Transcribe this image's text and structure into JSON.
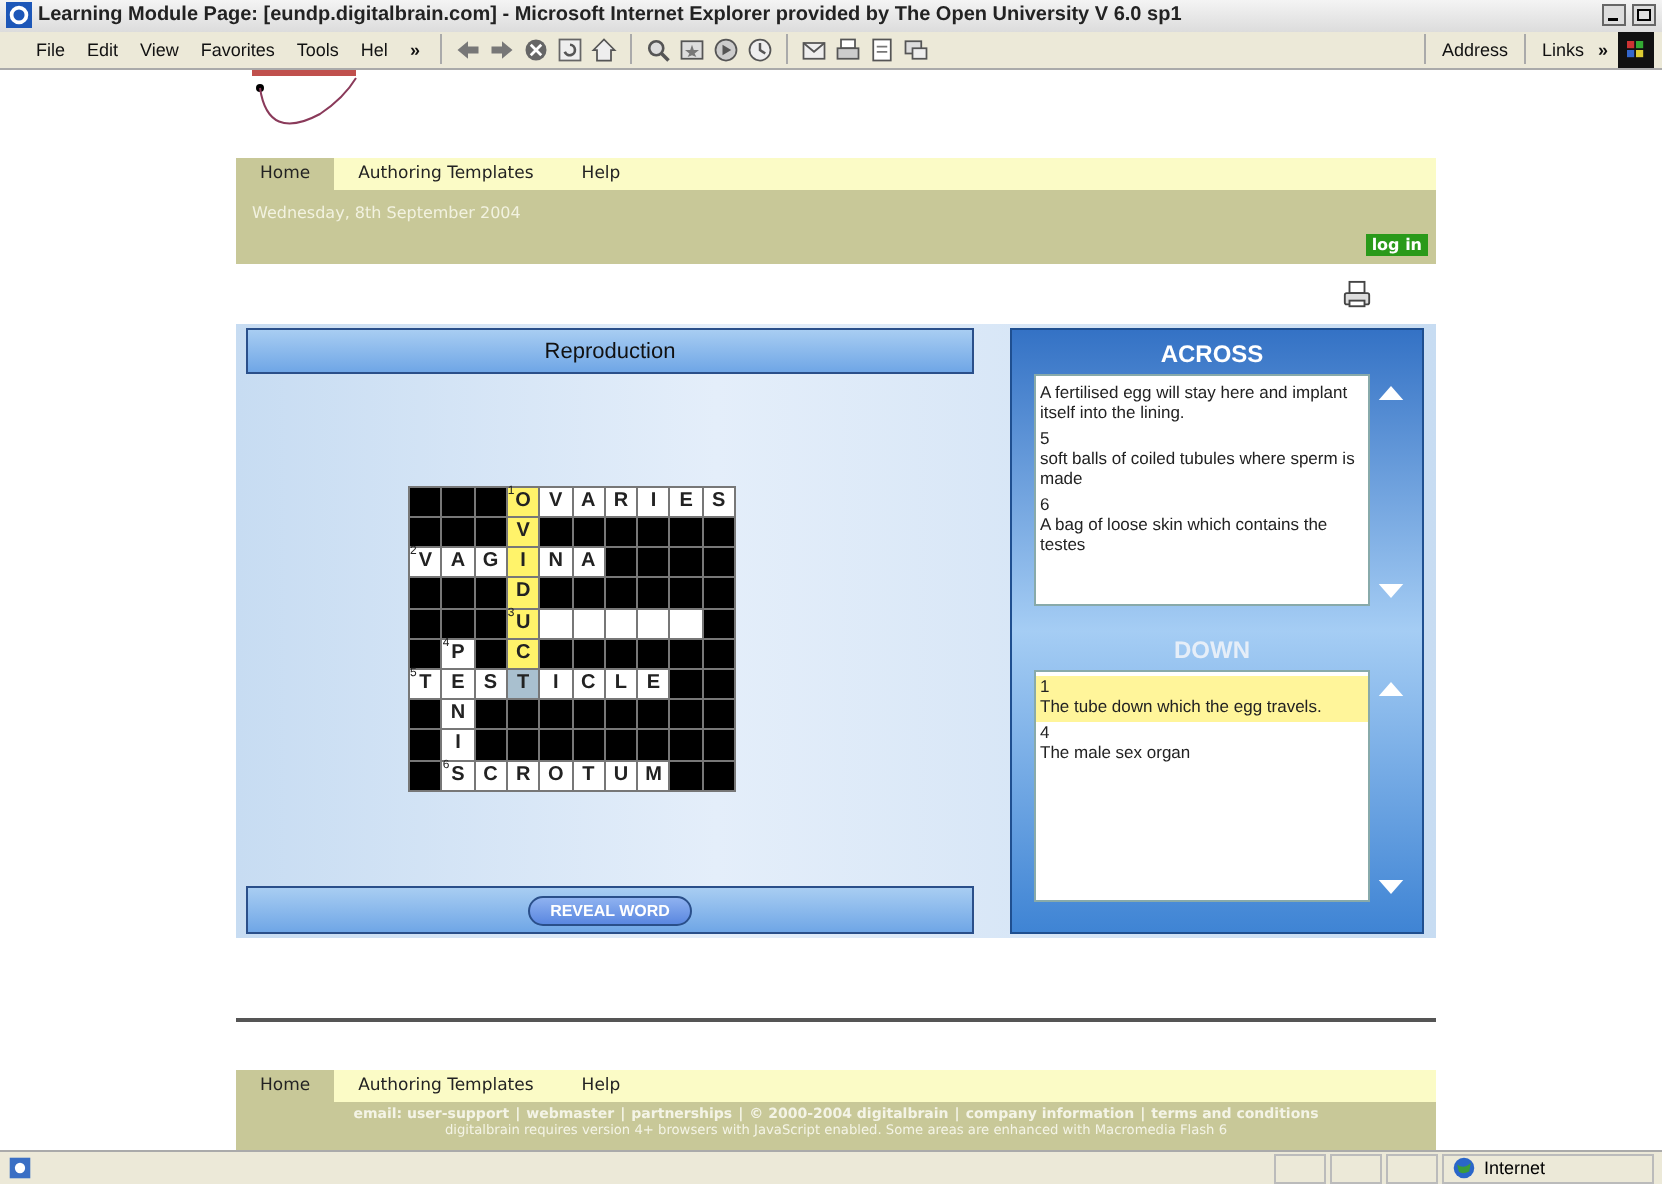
{
  "window": {
    "title": "Learning Module Page: [eundp.digitalbrain.com] - Microsoft Internet Explorer provided by The Open University V 6.0 sp1"
  },
  "menu": [
    "File",
    "Edit",
    "View",
    "Favorites",
    "Tools",
    "Hel"
  ],
  "menu_more": "»",
  "address_label": "Address",
  "links_label": "Links",
  "links_more": "»",
  "nav": [
    {
      "label": "Home",
      "selected": true
    },
    {
      "label": "Authoring Templates",
      "selected": false
    },
    {
      "label": "Help",
      "selected": false
    }
  ],
  "date": "Wednesday, 8th September 2004",
  "login": "log in",
  "puzzle": {
    "title": "Reproduction",
    "reveal": "REVEAL WORD",
    "grid": [
      [
        {
          "kind": "block"
        },
        {
          "kind": "block"
        },
        {
          "kind": "block"
        },
        {
          "kind": "letter",
          "letter": "O",
          "number": "1",
          "in_word": true,
          "selected": false
        },
        {
          "kind": "letter",
          "letter": "V",
          "in_word": false,
          "selected": false
        },
        {
          "kind": "letter",
          "letter": "A",
          "in_word": false,
          "selected": false
        },
        {
          "kind": "letter",
          "letter": "R",
          "in_word": false,
          "selected": false
        },
        {
          "kind": "letter",
          "letter": "I",
          "in_word": false,
          "selected": false
        },
        {
          "kind": "letter",
          "letter": "E",
          "in_word": false,
          "selected": false
        },
        {
          "kind": "letter",
          "letter": "S",
          "in_word": false,
          "selected": false
        }
      ],
      [
        {
          "kind": "block"
        },
        {
          "kind": "block"
        },
        {
          "kind": "block"
        },
        {
          "kind": "letter",
          "letter": "V",
          "in_word": true,
          "selected": false
        },
        {
          "kind": "block"
        },
        {
          "kind": "block"
        },
        {
          "kind": "block"
        },
        {
          "kind": "block"
        },
        {
          "kind": "block"
        },
        {
          "kind": "block"
        }
      ],
      [
        {
          "kind": "letter",
          "letter": "V",
          "number": "2",
          "in_word": false,
          "selected": false
        },
        {
          "kind": "letter",
          "letter": "A",
          "in_word": false,
          "selected": false
        },
        {
          "kind": "letter",
          "letter": "G",
          "in_word": false,
          "selected": false
        },
        {
          "kind": "letter",
          "letter": "I",
          "in_word": true,
          "selected": false
        },
        {
          "kind": "letter",
          "letter": "N",
          "in_word": false,
          "selected": false
        },
        {
          "kind": "letter",
          "letter": "A",
          "in_word": false,
          "selected": false
        },
        {
          "kind": "block"
        },
        {
          "kind": "block"
        },
        {
          "kind": "block"
        },
        {
          "kind": "block"
        }
      ],
      [
        {
          "kind": "block"
        },
        {
          "kind": "block"
        },
        {
          "kind": "block"
        },
        {
          "kind": "letter",
          "letter": "D",
          "in_word": true,
          "selected": false
        },
        {
          "kind": "block"
        },
        {
          "kind": "block"
        },
        {
          "kind": "block"
        },
        {
          "kind": "block"
        },
        {
          "kind": "block"
        },
        {
          "kind": "block"
        }
      ],
      [
        {
          "kind": "block"
        },
        {
          "kind": "block"
        },
        {
          "kind": "block"
        },
        {
          "kind": "letter",
          "letter": "U",
          "number": "3",
          "in_word": true,
          "selected": false
        },
        {
          "kind": "blank"
        },
        {
          "kind": "blank"
        },
        {
          "kind": "blank"
        },
        {
          "kind": "blank"
        },
        {
          "kind": "blank"
        },
        {
          "kind": "block"
        }
      ],
      [
        {
          "kind": "block"
        },
        {
          "kind": "letter",
          "letter": "P",
          "number": "4",
          "in_word": false,
          "selected": false
        },
        {
          "kind": "block"
        },
        {
          "kind": "letter",
          "letter": "C",
          "in_word": true,
          "selected": false
        },
        {
          "kind": "block"
        },
        {
          "kind": "block"
        },
        {
          "kind": "block"
        },
        {
          "kind": "block"
        },
        {
          "kind": "block"
        },
        {
          "kind": "block"
        }
      ],
      [
        {
          "kind": "letter",
          "letter": "T",
          "number": "5",
          "in_word": false,
          "selected": false
        },
        {
          "kind": "letter",
          "letter": "E",
          "in_word": false,
          "selected": false
        },
        {
          "kind": "letter",
          "letter": "S",
          "in_word": false,
          "selected": false
        },
        {
          "kind": "letter",
          "letter": "T",
          "in_word": false,
          "selected": true
        },
        {
          "kind": "letter",
          "letter": "I",
          "in_word": false,
          "selected": false
        },
        {
          "kind": "letter",
          "letter": "C",
          "in_word": false,
          "selected": false
        },
        {
          "kind": "letter",
          "letter": "L",
          "in_word": false,
          "selected": false
        },
        {
          "kind": "letter",
          "letter": "E",
          "in_word": false,
          "selected": false
        },
        {
          "kind": "block"
        },
        {
          "kind": "block"
        }
      ],
      [
        {
          "kind": "block"
        },
        {
          "kind": "letter",
          "letter": "N",
          "in_word": false,
          "selected": false
        },
        {
          "kind": "block"
        },
        {
          "kind": "block"
        },
        {
          "kind": "block"
        },
        {
          "kind": "block"
        },
        {
          "kind": "block"
        },
        {
          "kind": "block"
        },
        {
          "kind": "block"
        },
        {
          "kind": "block"
        }
      ],
      [
        {
          "kind": "block"
        },
        {
          "kind": "letter",
          "letter": "I",
          "in_word": false,
          "selected": false
        },
        {
          "kind": "block"
        },
        {
          "kind": "block"
        },
        {
          "kind": "block"
        },
        {
          "kind": "block"
        },
        {
          "kind": "block"
        },
        {
          "kind": "block"
        },
        {
          "kind": "block"
        },
        {
          "kind": "block"
        }
      ],
      [
        {
          "kind": "block"
        },
        {
          "kind": "letter",
          "letter": "S",
          "number": "6",
          "in_word": false,
          "selected": false
        },
        {
          "kind": "letter",
          "letter": "C",
          "in_word": false,
          "selected": false
        },
        {
          "kind": "letter",
          "letter": "R",
          "in_word": false,
          "selected": false
        },
        {
          "kind": "letter",
          "letter": "O",
          "in_word": false,
          "selected": false
        },
        {
          "kind": "letter",
          "letter": "T",
          "in_word": false,
          "selected": false
        },
        {
          "kind": "letter",
          "letter": "U",
          "in_word": false,
          "selected": false
        },
        {
          "kind": "letter",
          "letter": "M",
          "in_word": false,
          "selected": false
        },
        {
          "kind": "block"
        },
        {
          "kind": "block"
        }
      ]
    ]
  },
  "clue_panels": [
    {
      "title": "ACROSS",
      "active": true,
      "clues": [
        {
          "text": "A fertilised egg will stay here and implant itself into the lining.",
          "selected": false
        },
        {
          "number": "5",
          "text": "soft balls of coiled tubules where sperm is made",
          "selected": false
        },
        {
          "number": "6",
          "text": "A bag of loose skin which contains the testes",
          "selected": false
        }
      ]
    },
    {
      "title": "DOWN",
      "active": false,
      "clues": [
        {
          "number": "1",
          "text": "The tube down which the egg travels.",
          "selected": true
        },
        {
          "number": "4",
          "text": "The male sex organ",
          "selected": false
        }
      ]
    }
  ],
  "footer_nav": [
    {
      "label": "Home",
      "selected": true
    },
    {
      "label": "Authoring Templates",
      "selected": false
    },
    {
      "label": "Help",
      "selected": false
    }
  ],
  "footer_links": [
    "email: user-support",
    "webmaster",
    "partnerships",
    "© 2000-2004 digitalbrain",
    "company information",
    "terms and conditions"
  ],
  "footer_separator": "|",
  "footer_note": "digitalbrain requires version 4+ browsers with JavaScript enabled. Some areas are enhanced with Macromedia Flash 6",
  "status": {
    "zone": "Internet"
  }
}
